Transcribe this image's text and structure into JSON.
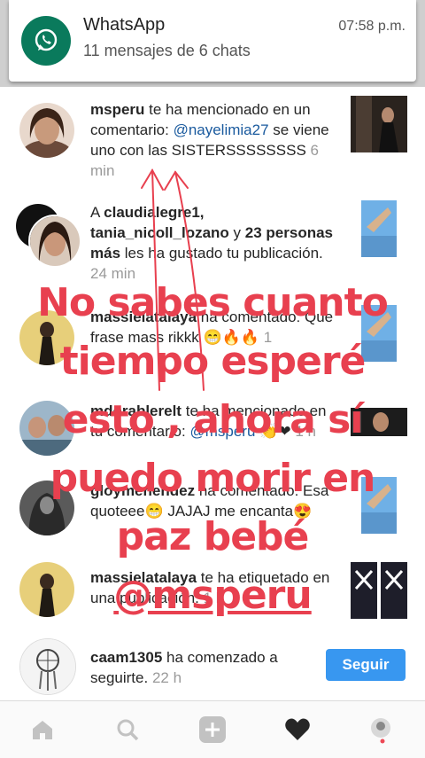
{
  "notification": {
    "app_name": "WhatsApp",
    "summary": "11 mensajes de 6 chats",
    "time": "07:58 p.m."
  },
  "activity": [
    {
      "user": "msperu",
      "action": "te ha mencionado en un comentario:",
      "mention": "@nayelimia27",
      "comment": "se viene uno con las SISTERSSSSSSSS",
      "time": "6 min"
    },
    {
      "prefix": "A",
      "user1": "claudialegre1,",
      "user2": "tania_nicoll_lozano",
      "conj": "y",
      "others": "23 personas más",
      "action": "les ha gustado tu publicación.",
      "time": "24 min"
    },
    {
      "user": "massielatalaya",
      "action": "ha comentado:",
      "comment": "Que frase mass rikkk 😁🔥🔥",
      "time": "1"
    },
    {
      "user": "mdorablerelt",
      "action": "te ha mencionado en tu comentario:",
      "mention": "@msperu",
      "comment": "👏❤",
      "time": "1 h"
    },
    {
      "user": "gloymenendez",
      "action": "ha comentado:",
      "comment": "Esa quoteee😁 JAJAJ me encanta😍"
    },
    {
      "user": "massielatalaya",
      "action": "te ha etiquetado en una publicación.",
      "time": "1 h"
    },
    {
      "user": "caam1305",
      "action": "ha comenzado a seguirte.",
      "time": "22 h",
      "button": "Seguir"
    }
  ],
  "overlay_text": [
    "No sabes cuanto",
    "tiempo esperé",
    "esto , ahora sí",
    "puedo morir en",
    "paz bebé",
    "@msperu"
  ],
  "colors": {
    "overlay": "#e8404f",
    "follow_button": "#3897f0",
    "whatsapp": "#0a7a5c"
  }
}
